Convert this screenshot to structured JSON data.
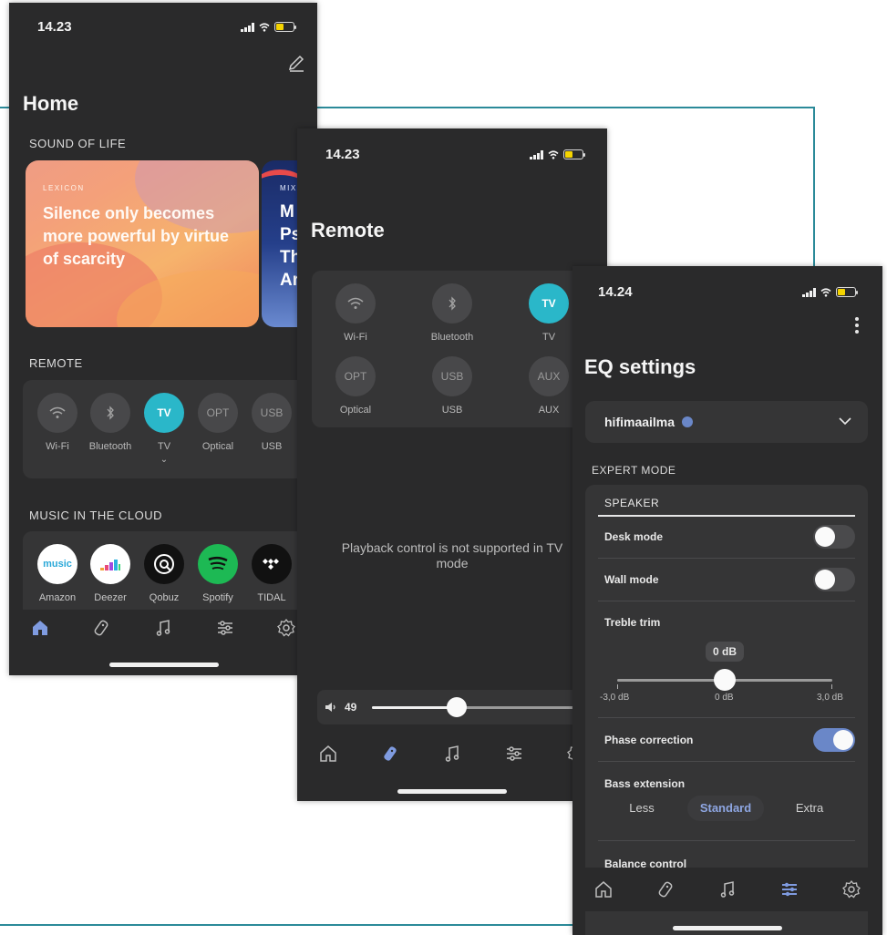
{
  "home": {
    "time": "14.23",
    "title": "Home",
    "sound_of_life": {
      "label": "SOUND OF LIFE",
      "card1_kicker": "LEXICON",
      "card1_text": "Silence only becomes more powerful by virtue of scarcity",
      "card2_kicker": "MIX",
      "card2_lines": [
        "M",
        "Ps",
        "Th",
        "Ar"
      ]
    },
    "remote": {
      "label": "REMOTE",
      "sources": [
        {
          "label": "Wi-Fi",
          "icon": "wifi-icon"
        },
        {
          "label": "Bluetooth",
          "icon": "bluetooth-icon"
        },
        {
          "label": "TV",
          "badge": "TV",
          "active": true
        },
        {
          "label": "Optical",
          "badge": "OPT"
        },
        {
          "label": "USB",
          "badge": "USB"
        }
      ]
    },
    "music": {
      "label": "MUSIC IN THE CLOUD",
      "services": [
        {
          "label": "Amazon",
          "badge": "music"
        },
        {
          "label": "Deezer"
        },
        {
          "label": "Qobuz"
        },
        {
          "label": "Spotify"
        },
        {
          "label": "TIDAL"
        }
      ]
    }
  },
  "remote_screen": {
    "time": "14.23",
    "title": "Remote",
    "sources": [
      {
        "label": "Wi-Fi",
        "icon": "wifi-icon"
      },
      {
        "label": "Bluetooth",
        "icon": "bluetooth-icon"
      },
      {
        "label": "TV",
        "badge": "TV",
        "active": true
      },
      {
        "label": "Optical",
        "badge": "OPT"
      },
      {
        "label": "USB",
        "badge": "USB"
      },
      {
        "label": "AUX",
        "badge": "AUX"
      }
    ],
    "message": "Playback control is not supported in TV mode",
    "volume": 49,
    "volume_fraction": 0.36
  },
  "eq": {
    "time": "14.24",
    "title": "EQ settings",
    "profile": "hifimaailma",
    "expert_mode_label": "EXPERT MODE",
    "speaker_label": "SPEAKER",
    "desk_mode": {
      "label": "Desk mode",
      "on": false
    },
    "wall_mode": {
      "label": "Wall mode",
      "on": false
    },
    "treble": {
      "label": "Treble trim",
      "value_label": "0 dB",
      "min_label": "-3,0 dB",
      "mid_label": "0 dB",
      "max_label": "3,0 dB",
      "value": 0,
      "min": -3.0,
      "max": 3.0
    },
    "phase_correction": {
      "label": "Phase correction",
      "on": true
    },
    "bass_extension": {
      "label": "Bass extension",
      "options": [
        "Less",
        "Standard",
        "Extra"
      ],
      "selected": "Standard"
    },
    "balance_label": "Balance control"
  },
  "colors": {
    "phone_bg": "#2a2a2b",
    "panel_bg": "#353536",
    "accent_teal": "#2ab7c9",
    "accent_blue": "#6a87c8",
    "frame_line": "#2b8a99"
  }
}
